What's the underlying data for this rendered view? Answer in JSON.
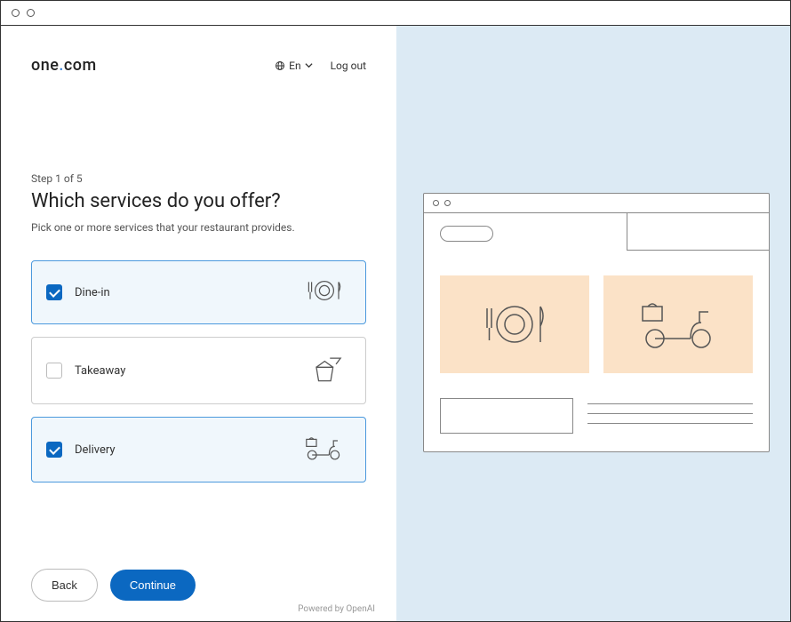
{
  "brand": {
    "part1": "one",
    "dot": ".",
    "part2": "com"
  },
  "header": {
    "language_label": "En",
    "logout_label": "Log out"
  },
  "wizard": {
    "step_label": "Step 1 of 5",
    "title": "Which services do you offer?",
    "subtitle": "Pick one or more services that your restaurant provides."
  },
  "options": [
    {
      "id": "dine-in",
      "label": "Dine-in",
      "selected": true,
      "icon": "plate"
    },
    {
      "id": "takeaway",
      "label": "Takeaway",
      "selected": false,
      "icon": "bag"
    },
    {
      "id": "delivery",
      "label": "Delivery",
      "selected": true,
      "icon": "scooter"
    }
  ],
  "buttons": {
    "back": "Back",
    "continue": "Continue"
  },
  "footer": {
    "powered": "Powered by OpenAI"
  }
}
